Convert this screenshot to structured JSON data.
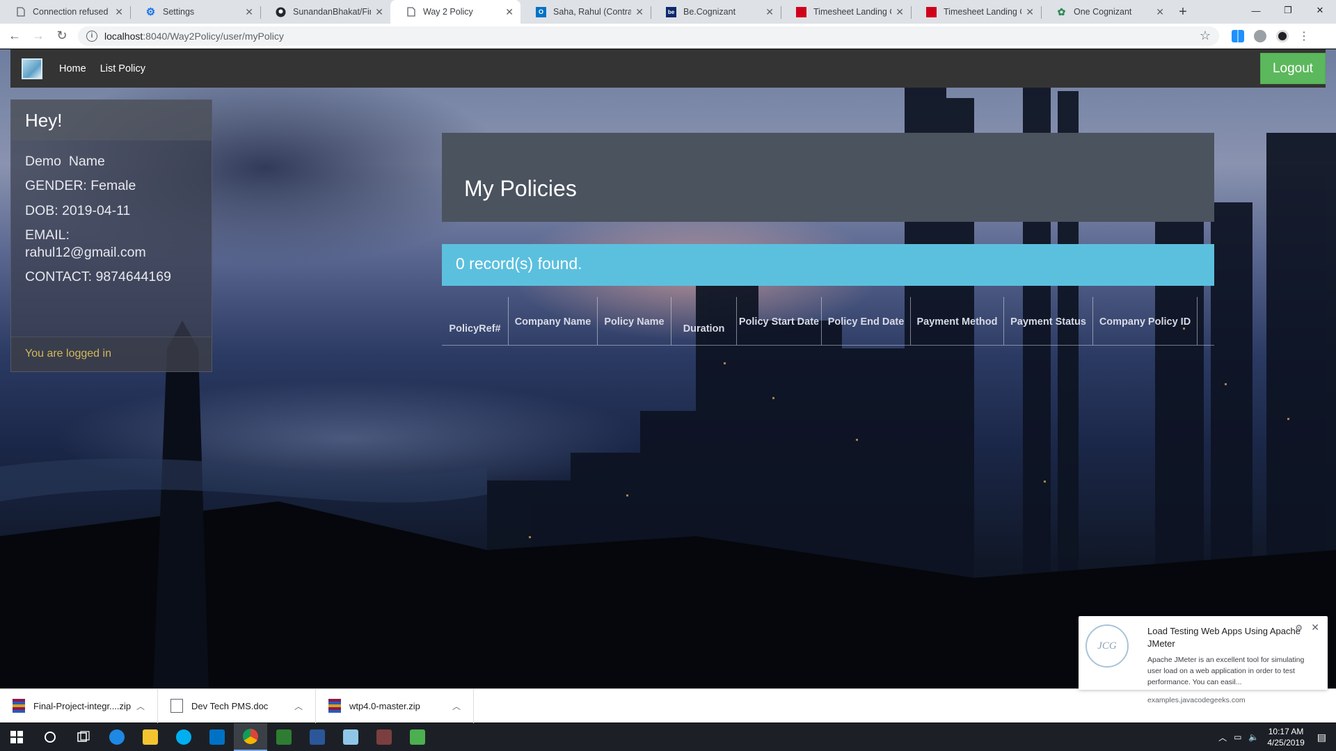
{
  "browser": {
    "tabs": [
      {
        "title": "Connection refused",
        "icon": "page-icon"
      },
      {
        "title": "Settings",
        "icon": "gear-icon"
      },
      {
        "title": "SunandanBhakat/Final-",
        "icon": "github-icon"
      },
      {
        "title": "Way 2 Policy",
        "icon": "page-icon",
        "active": true
      },
      {
        "title": "Saha, Rahul (Contractor",
        "icon": "outlook-icon"
      },
      {
        "title": "Be.Cognizant",
        "icon": "be-icon"
      },
      {
        "title": "Timesheet Landing Co",
        "icon": "timesheet-icon"
      },
      {
        "title": "Timesheet Landing Co",
        "icon": "timesheet-icon"
      },
      {
        "title": "One Cognizant",
        "icon": "cognizant-icon"
      }
    ],
    "url_host": "localhost",
    "url_path": ":8040/Way2Policy/user/myPolicy"
  },
  "nav": {
    "home": "Home",
    "list_policy": "List Policy",
    "logout": "Logout"
  },
  "profile": {
    "greeting": "Hey!",
    "name": "Demo  Name",
    "gender": "GENDER: Female",
    "dob": "DOB: 2019-04-11",
    "email_label": "EMAIL:",
    "email": "rahul12@gmail.com",
    "contact": "CONTACT: 9874644169",
    "status": "You are logged in"
  },
  "main": {
    "title": "My Policies",
    "records_msg": "0 record(s) found.",
    "columns": [
      "PolicyRef#",
      "Company Name",
      "Policy Name",
      "Duration",
      "Policy Start Date",
      "Policy End Date",
      "Payment Method",
      "Payment Status",
      "Company Policy ID"
    ]
  },
  "downloads": [
    {
      "name": "Final-Project-integr....zip",
      "icon": "winrar-icon"
    },
    {
      "name": "Dev Tech PMS.doc",
      "icon": "doc-icon"
    },
    {
      "name": "wtp4.0-master.zip",
      "icon": "winrar-icon"
    }
  ],
  "notification": {
    "title": "Load Testing Web Apps Using Apache JMeter",
    "body": "Apache JMeter is an excellent tool for simulating user load on a web application in order to test performance. You can easil...",
    "source": "examples.javacodegeeks.com",
    "logo_text": "JCG"
  },
  "taskbar": {
    "time": "10:17 AM",
    "date": "4/25/2019"
  },
  "colors": {
    "navbar": "#343434",
    "logout": "#5cb85c",
    "alert": "#5bc0de",
    "jumbotron": "#4b535f",
    "logged_in_text": "#d4b85a"
  }
}
